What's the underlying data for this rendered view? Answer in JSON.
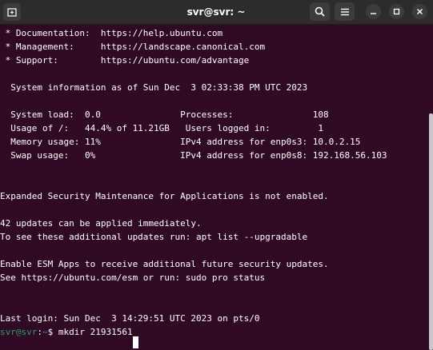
{
  "window": {
    "title": "svr@svr: ~"
  },
  "icons": {
    "new_tab": "new-tab-icon",
    "search": "search-icon",
    "menu": "hamburger-menu-icon",
    "minimize": "minimize-icon",
    "maximize": "maximize-icon",
    "close": "close-icon"
  },
  "colors": {
    "terminal_bg": "#300a24",
    "titlebar_bg": "#2c2c2c",
    "prompt_user": "#26a269",
    "prompt_path": "#3b8eea",
    "text": "#ffffff"
  },
  "terminal": {
    "lines": [
      " * Documentation:  https://help.ubuntu.com",
      " * Management:     https://landscape.canonical.com",
      " * Support:        https://ubuntu.com/advantage",
      "",
      "  System information as of Sun Dec  3 02:33:38 PM UTC 2023",
      "",
      "  System load:  0.0               Processes:               108",
      "  Usage of /:   44.4% of 11.21GB   Users logged in:         1",
      "  Memory usage: 11%               IPv4 address for enp0s3: 10.0.2.15",
      "  Swap usage:   0%                IPv4 address for enp0s8: 192.168.56.103",
      "",
      "",
      "Expanded Security Maintenance for Applications is not enabled.",
      "",
      "42 updates can be applied immediately.",
      "To see these additional updates run: apt list --upgradable",
      "",
      "Enable ESM Apps to receive additional future security updates.",
      "See https://ubuntu.com/esm or run: sudo pro status",
      "",
      "",
      "",
      "Last login: Sun Dec  3 14:29:51 UTC 2023 on pts/0"
    ],
    "prompt": {
      "user_host": "svr@svr",
      "separator": ":",
      "path": "~",
      "symbol": "$ ",
      "command": "mkdir 21931561"
    }
  }
}
